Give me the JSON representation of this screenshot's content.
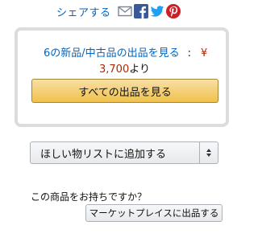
{
  "share": {
    "label": "シェアする",
    "icons": [
      "email-icon",
      "facebook-icon",
      "twitter-icon",
      "pinterest-icon"
    ],
    "colors": {
      "email": "#7a8594",
      "facebook": "#3b5998",
      "twitter": "#1da1f2",
      "pinterest": "#cb2027"
    }
  },
  "offers": {
    "link_text": "6の新品/中古品の出品を見る",
    "separator": ":",
    "currency": "¥",
    "price": "3,700",
    "price_suffix": "より",
    "button_label": "すべての出品を見る"
  },
  "wishlist": {
    "label": "ほしい物リストに追加する"
  },
  "sell": {
    "question": "この商品をお持ちですか？",
    "button_label": "マーケットプレイスに出品する"
  },
  "colors": {
    "link": "#0066c0",
    "price": "#b12704",
    "primary_button": "#f0c14b"
  }
}
